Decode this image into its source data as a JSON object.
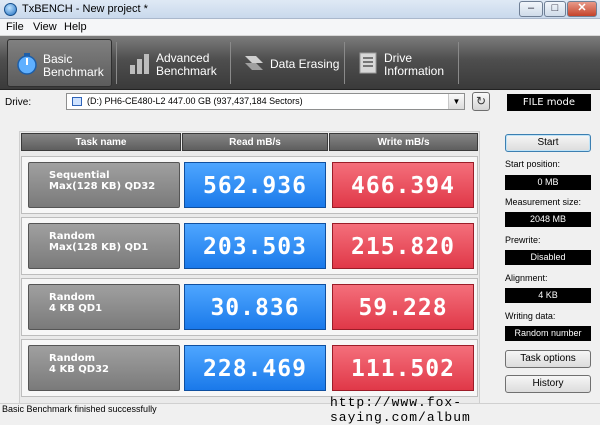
{
  "window": {
    "title": "TxBENCH - New project *",
    "controls": {
      "minimize": "–",
      "maximize": "□",
      "close": "✕"
    }
  },
  "menu": [
    "File",
    "View",
    "Help"
  ],
  "tabs": [
    {
      "label": "Basic\nBenchmark",
      "icon": "gauge-icon",
      "active": true
    },
    {
      "label": "Advanced\nBenchmark",
      "icon": "bar-chart-icon",
      "active": false
    },
    {
      "label": "Data Erasing",
      "icon": "eraser-icon",
      "active": false
    },
    {
      "label": "Drive\nInformation",
      "icon": "drive-info-icon",
      "active": false
    }
  ],
  "drive": {
    "label": "Drive:",
    "selected": "(D:) PH6-CE480-L2  447.00 GB (937,437,184 Sectors)",
    "mode": "FILE mode"
  },
  "table": {
    "headers": {
      "task": "Task name",
      "read": "Read mB/s",
      "write": "Write mB/s"
    },
    "rows": [
      {
        "line1": "Sequential",
        "line2": "Max(128 KB) QD32",
        "read": "562.936",
        "write": "466.394"
      },
      {
        "line1": "Random",
        "line2": "Max(128 KB) QD1",
        "read": "203.503",
        "write": "215.820"
      },
      {
        "line1": "Random",
        "line2": "4 KB QD1",
        "read": "30.836",
        "write": "59.228"
      },
      {
        "line1": "Random",
        "line2": "4 KB QD32",
        "read": "228.469",
        "write": "111.502"
      }
    ]
  },
  "side": {
    "start": "Start",
    "start_position_label": "Start position:",
    "start_position": "0 MB",
    "measurement_size_label": "Measurement size:",
    "measurement_size": "2048 MB",
    "prewrite_label": "Prewrite:",
    "prewrite": "Disabled",
    "alignment_label": "Alignment:",
    "alignment": "4 KB",
    "writing_data_label": "Writing data:",
    "writing_data": "Random number",
    "task_options": "Task options",
    "history": "History"
  },
  "status": "Basic Benchmark finished successfully",
  "watermark": "http://www.fox-saying.com/album",
  "colors": {
    "read": "#2a8cf5",
    "write": "#ea4f5e",
    "toolbar": "#4e4e4e"
  }
}
